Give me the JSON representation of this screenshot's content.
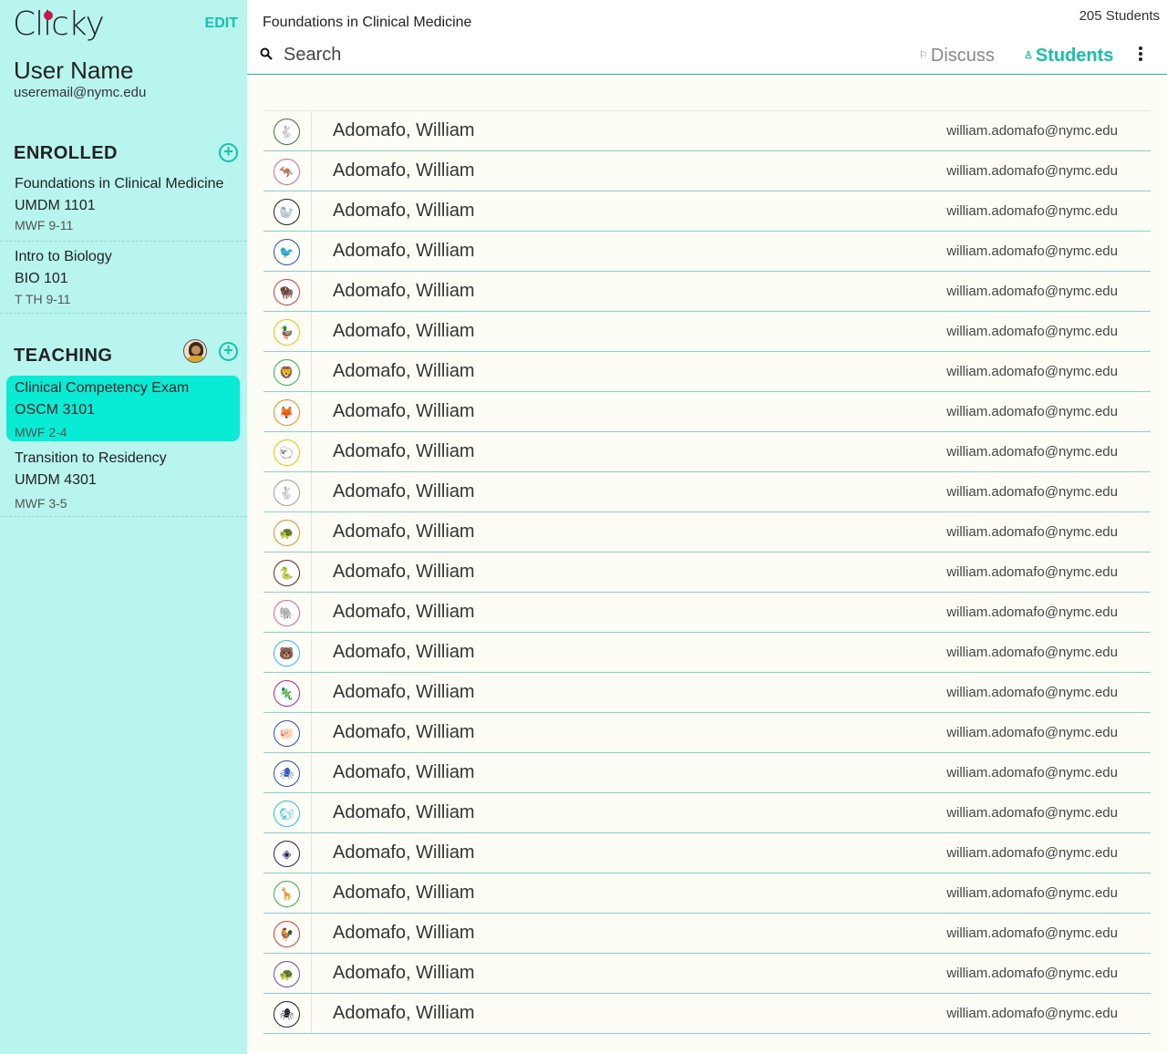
{
  "app": {
    "logo": "Clicky",
    "edit_label": "EDIT"
  },
  "user": {
    "name": "User Name",
    "email": "useremail@nymc.edu"
  },
  "enrolled": {
    "title": "ENROLLED",
    "courses": [
      {
        "title": "Foundations in Clinical Medicine",
        "code": "UMDM 1101",
        "time": "MWF 9-11"
      },
      {
        "title": "Intro to Biology",
        "code": "BIO 101",
        "time": "T TH 9-11"
      }
    ]
  },
  "teaching": {
    "title": "TEACHING",
    "courses": [
      {
        "title": "Clinical Competency Exam",
        "code": "OSCM 3101",
        "time": "MWF 2-4",
        "active": true
      },
      {
        "title": "Transition to Residency",
        "code": "UMDM 4301",
        "time": "MWF 3-5"
      }
    ]
  },
  "header": {
    "course_title": "Foundations in Clinical Medicine",
    "student_count": "205 Students",
    "search_placeholder": "Search",
    "tabs": {
      "discuss": "Discuss",
      "students": "Students"
    },
    "active_tab": "students"
  },
  "students": [
    {
      "name": "Adomafo, William",
      "email": "william.adomafo@nymc.edu",
      "icon": "rabbit-icon",
      "color": "#2e7d32"
    },
    {
      "name": "Adomafo, William",
      "email": "william.adomafo@nymc.edu",
      "icon": "kangaroo-icon",
      "color": "#e8609a"
    },
    {
      "name": "Adomafo, William",
      "email": "william.adomafo@nymc.edu",
      "icon": "seal-icon",
      "color": "#222222"
    },
    {
      "name": "Adomafo, William",
      "email": "william.adomafo@nymc.edu",
      "icon": "bird-icon",
      "color": "#2b4fc7"
    },
    {
      "name": "Adomafo, William",
      "email": "william.adomafo@nymc.edu",
      "icon": "bison-icon",
      "color": "#e53935"
    },
    {
      "name": "Adomafo, William",
      "email": "william.adomafo@nymc.edu",
      "icon": "duck-icon",
      "color": "#f2c200"
    },
    {
      "name": "Adomafo, William",
      "email": "william.adomafo@nymc.edu",
      "icon": "lion-icon",
      "color": "#2fb34a"
    },
    {
      "name": "Adomafo, William",
      "email": "william.adomafo@nymc.edu",
      "icon": "fox-icon",
      "color": "#f08a24"
    },
    {
      "name": "Adomafo, William",
      "email": "william.adomafo@nymc.edu",
      "icon": "sheep-icon",
      "color": "#f2c200"
    },
    {
      "name": "Adomafo, William",
      "email": "william.adomafo@nymc.edu",
      "icon": "rabbit-icon",
      "color": "#9e9e9e"
    },
    {
      "name": "Adomafo, William",
      "email": "william.adomafo@nymc.edu",
      "icon": "turtle-icon",
      "color": "#f08a24"
    },
    {
      "name": "Adomafo, William",
      "email": "william.adomafo@nymc.edu",
      "icon": "snake-icon",
      "color": "#8b1a1a"
    },
    {
      "name": "Adomafo, William",
      "email": "william.adomafo@nymc.edu",
      "icon": "elephant-icon",
      "color": "#e8609a"
    },
    {
      "name": "Adomafo, William",
      "email": "william.adomafo@nymc.edu",
      "icon": "bear-icon",
      "color": "#29c4d6"
    },
    {
      "name": "Adomafo, William",
      "email": "william.adomafo@nymc.edu",
      "icon": "lizard-icon",
      "color": "#d81b7a"
    },
    {
      "name": "Adomafo, William",
      "email": "william.adomafo@nymc.edu",
      "icon": "pig-icon",
      "color": "#2b4fc7"
    },
    {
      "name": "Adomafo, William",
      "email": "william.adomafo@nymc.edu",
      "icon": "spider-icon",
      "color": "#2b4fc7"
    },
    {
      "name": "Adomafo, William",
      "email": "william.adomafo@nymc.edu",
      "icon": "squirrel-icon",
      "color": "#29c4d6"
    },
    {
      "name": "Adomafo, William",
      "email": "william.adomafo@nymc.edu",
      "icon": "stingray-icon",
      "color": "#2a1f5c"
    },
    {
      "name": "Adomafo, William",
      "email": "william.adomafo@nymc.edu",
      "icon": "giraffe-icon",
      "color": "#2fb34a"
    },
    {
      "name": "Adomafo, William",
      "email": "william.adomafo@nymc.edu",
      "icon": "rooster-icon",
      "color": "#e53935"
    },
    {
      "name": "Adomafo, William",
      "email": "william.adomafo@nymc.edu",
      "icon": "turtle-icon",
      "color": "#7b3fc4"
    },
    {
      "name": "Adomafo, William",
      "email": "william.adomafo@nymc.edu",
      "icon": "spider-icon",
      "color": "#222222"
    }
  ],
  "colors": {
    "accent": "#14c2ad",
    "sidebar_bg": "#b8f5ef",
    "active_course_bg": "#08ecd6",
    "logo_dot": "#c8174a"
  }
}
